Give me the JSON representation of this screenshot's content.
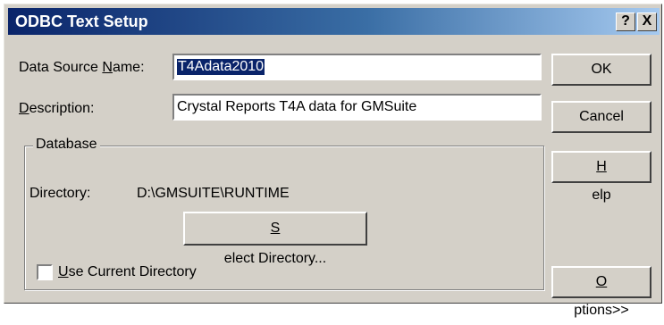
{
  "window": {
    "title": "ODBC Text Setup",
    "help_button": "?",
    "close_button": "X"
  },
  "form": {
    "dsn_label": "Data Source Name:",
    "dsn_value": "T4Adata2010",
    "desc_label": "Description:",
    "desc_value": "Crystal Reports T4A data for GMSuite"
  },
  "database": {
    "legend": "Database",
    "directory_label": "Directory:",
    "directory_value": "D:\\GMSUITE\\RUNTIME",
    "select_button": "Select Directory...",
    "use_current_label": "Use Current Directory",
    "use_current_checked": false
  },
  "buttons": {
    "ok": "OK",
    "cancel": "Cancel",
    "help": "Help",
    "options": "Options>>"
  },
  "colors": {
    "title_start": "#0a246a",
    "title_end": "#a6caf0",
    "face": "#d4d0c8",
    "selection": "#0a246a"
  }
}
